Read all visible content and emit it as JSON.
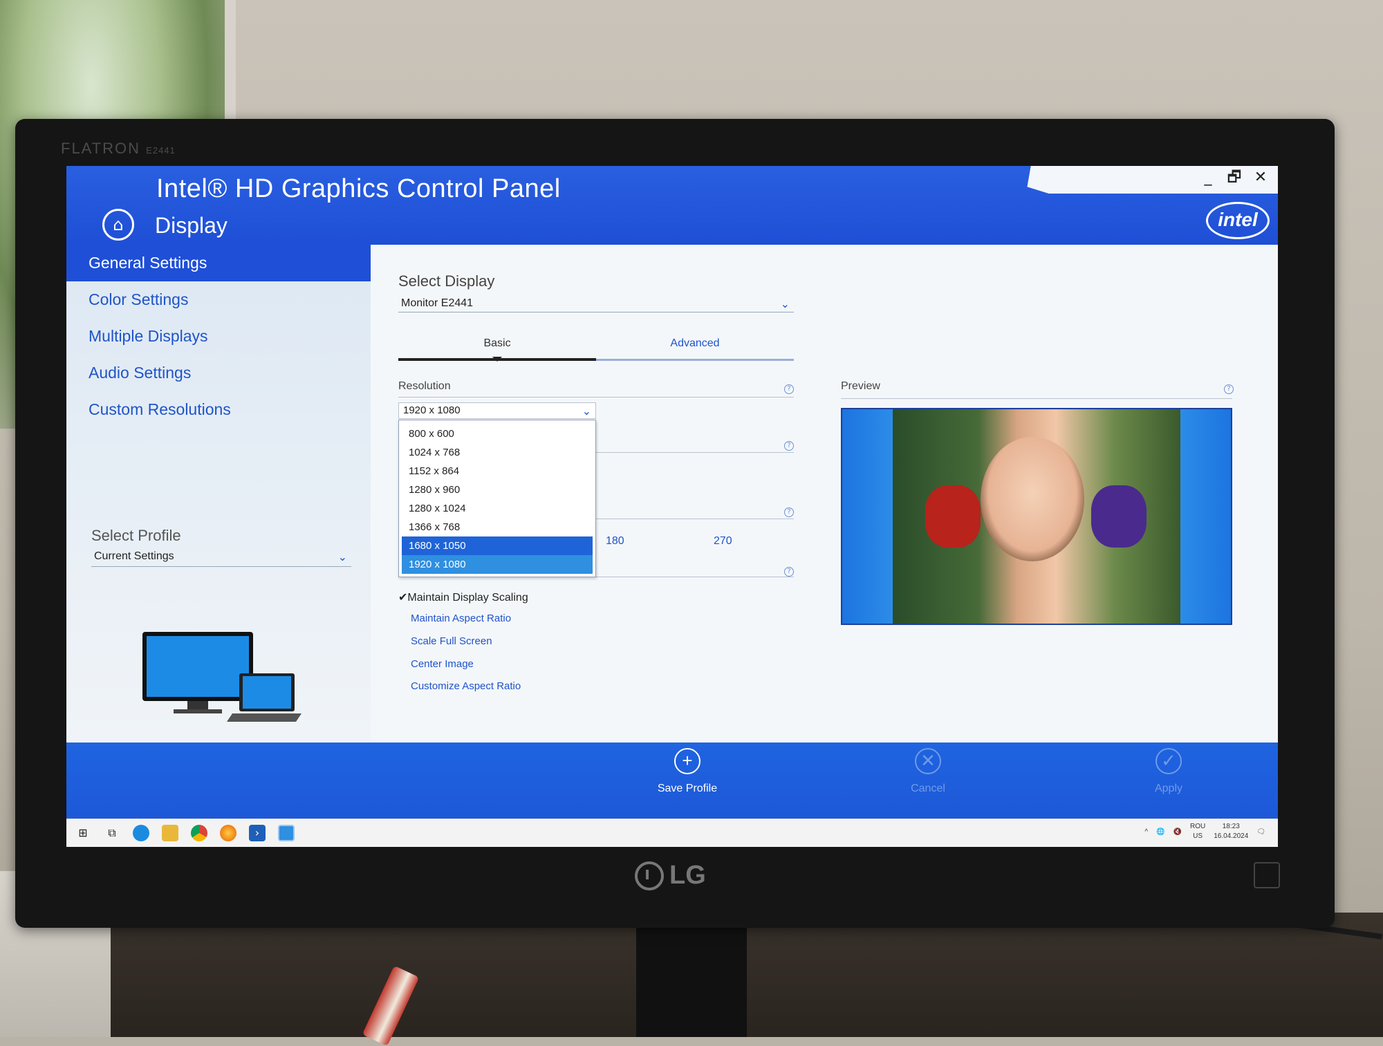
{
  "monitor": {
    "brand": "FLATRON",
    "model": "E2441",
    "logo": "LG"
  },
  "app": {
    "title": "Intel® HD Graphics Control Panel",
    "section": "Display",
    "logo_text": "intel"
  },
  "window_controls": {
    "minimize": "_",
    "restore": "🗗",
    "close": "✕"
  },
  "sidebar": {
    "items": [
      {
        "label": "General Settings",
        "active": true
      },
      {
        "label": "Color Settings",
        "active": false
      },
      {
        "label": "Multiple Displays",
        "active": false
      },
      {
        "label": "Audio Settings",
        "active": false
      },
      {
        "label": "Custom Resolutions",
        "active": false
      }
    ],
    "profile_label": "Select Profile",
    "profile_value": "Current Settings"
  },
  "main": {
    "select_display_label": "Select Display",
    "display_value": "Monitor E2441",
    "tabs": [
      {
        "label": "Basic",
        "active": true
      },
      {
        "label": "Advanced",
        "active": false
      }
    ],
    "resolution_label": "Resolution",
    "resolution_value": "1920 x 1080",
    "resolution_options": [
      "800 x 600",
      "1024 x 768",
      "1152 x 864",
      "1280 x 960",
      "1280 x 1024",
      "1366 x 768",
      "1680 x 1050",
      "1920 x 1080"
    ],
    "rotation_visible": [
      "180",
      "270"
    ],
    "scaling": {
      "checked_label": "Maintain Display Scaling",
      "options": [
        "Maintain Aspect Ratio",
        "Scale Full Screen",
        "Center Image",
        "Customize Aspect Ratio"
      ]
    },
    "preview_label": "Preview",
    "help_symbol": "?"
  },
  "actions": {
    "save": {
      "label": "Save Profile",
      "icon": "+"
    },
    "cancel": {
      "label": "Cancel",
      "icon": "✕"
    },
    "apply": {
      "label": "Apply",
      "icon": "✓"
    }
  },
  "taskbar": {
    "lang_top": "ROU",
    "lang_bottom": "US",
    "time": "18:23",
    "date": "16.04.2024"
  },
  "colors": {
    "intel_blue": "#1e4fd6",
    "highlight": "#1e64d8",
    "highlight_alt": "#2f8fe0"
  }
}
